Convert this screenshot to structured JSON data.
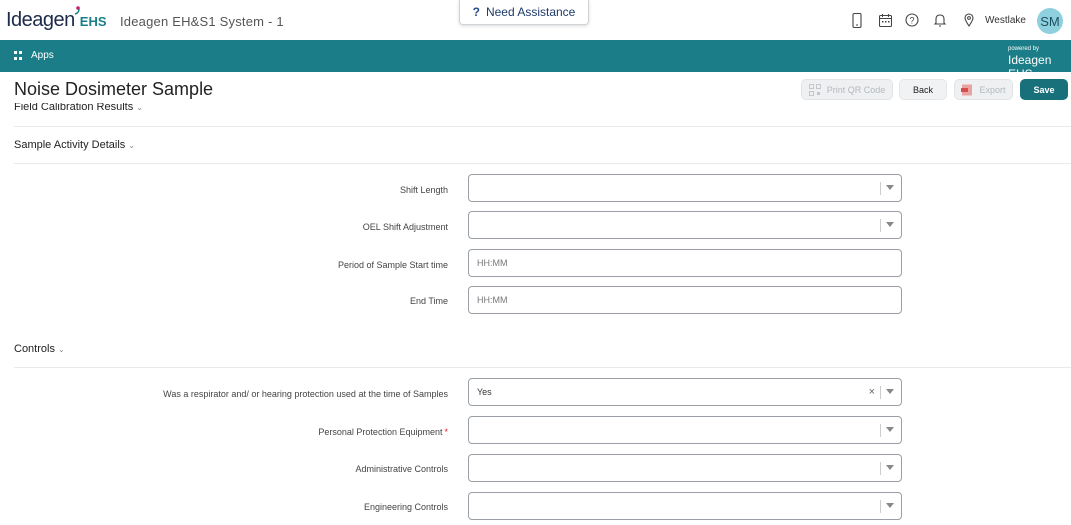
{
  "header": {
    "logo_main": "Ideagen",
    "logo_suffix": "EHS",
    "system_title": "Ideagen EH&S1 System - 1",
    "assist_label": "Need Assistance",
    "location": "Westlake",
    "avatar_initials": "SM",
    "icons": [
      "mobile-icon",
      "calendar-icon",
      "help-icon",
      "bell-icon",
      "location-pin-icon"
    ]
  },
  "nav": {
    "apps_label": "Apps",
    "powered_by": "powered by",
    "powered_logo": "Ideagen EHS"
  },
  "page": {
    "title": "Noise Dosimeter Sample",
    "buttons": {
      "print_qr": "Print QR Code",
      "back": "Back",
      "export": "Export",
      "save": "Save"
    }
  },
  "sections": {
    "field_calibration": "Field Calibration Results",
    "sample_activity": "Sample Activity Details",
    "controls": "Controls"
  },
  "sample_fields": {
    "shift_length": {
      "label": "Shift Length",
      "value": ""
    },
    "oel_shift_adjustment": {
      "label": "OEL Shift Adjustment",
      "value": ""
    },
    "period_start": {
      "label": "Period of Sample Start time",
      "placeholder": "HH:MM"
    },
    "end_time": {
      "label": "End Time",
      "placeholder": "HH:MM"
    }
  },
  "control_fields": {
    "respirator_used": {
      "label": "Was a respirator and/ or hearing protection used at the time of Samples",
      "value": "Yes"
    },
    "ppe": {
      "label": "Personal Protection Equipment",
      "required_mark": "*",
      "value": ""
    },
    "administrative": {
      "label": "Administrative Controls",
      "value": ""
    },
    "engineering": {
      "label": "Engineering Controls",
      "value": ""
    }
  },
  "colors": {
    "teal_bar": "#1a7d87",
    "save_button": "#17707a",
    "avatar": "#8fd0df",
    "required": "#dd2233"
  }
}
